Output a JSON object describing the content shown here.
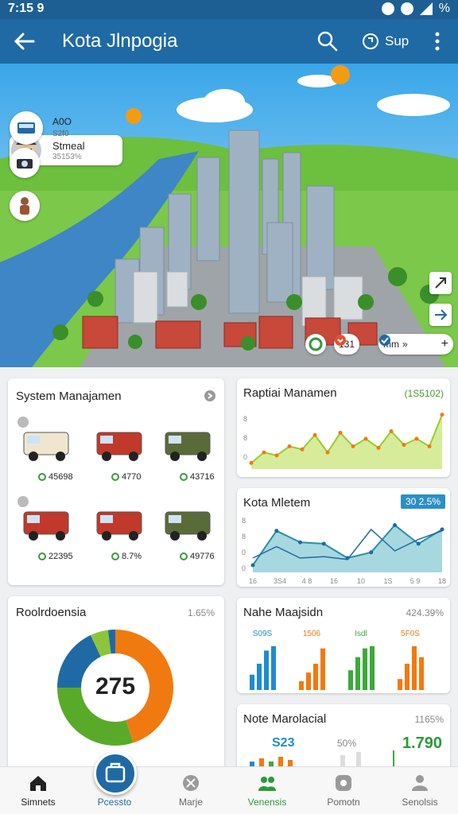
{
  "status": {
    "time": "7:15 9",
    "battery": "%"
  },
  "appbar": {
    "title": "Kota Jlnpogia",
    "action_label": "Sup"
  },
  "user": {
    "name": "Stmeal",
    "sub": "35153%"
  },
  "side_chips": [
    {
      "label": "A0O",
      "sub": "S2f0"
    }
  ],
  "map_pills": [
    {
      "value": "131"
    },
    {
      "value": "mm"
    }
  ],
  "system_card": {
    "title": "System Manajamen",
    "vehicles": [
      {
        "value": "45698",
        "color": "#f0e6d0",
        "icon": "box-truck-icon"
      },
      {
        "value": "4770",
        "color": "#c0392b",
        "icon": "car-icon"
      },
      {
        "value": "43716",
        "color": "#5a6b3a",
        "icon": "military-truck-icon"
      },
      {
        "value": "22395",
        "color": "#c0392b",
        "icon": "bus-icon"
      },
      {
        "value": "8.7%",
        "color": "#c0392b",
        "icon": "bus-icon"
      },
      {
        "value": "49776",
        "color": "#5a6b3a",
        "icon": "jeep-icon"
      }
    ]
  },
  "rapid_card": {
    "title": "Raptiai Manamen",
    "value": "(1S5102)",
    "chart_data": {
      "type": "area",
      "values": [
        8,
        22,
        18,
        30,
        26,
        45,
        22,
        48,
        30,
        40,
        28,
        50,
        32,
        40,
        30,
        72
      ],
      "color": "#9bcc2a",
      "ylim": [
        0,
        80
      ]
    }
  },
  "kota_card": {
    "title": "Kota Mletem",
    "badge": "30 2.5%",
    "chart_data": {
      "type": "area",
      "x": [
        "16",
        "3S4",
        "4 8",
        "16",
        "10",
        "1S",
        "5 9",
        "18"
      ],
      "values": [
        10,
        58,
        42,
        40,
        20,
        28,
        66,
        40,
        60
      ],
      "line2": [
        20,
        36,
        20,
        22,
        18,
        60,
        30,
        46,
        58
      ],
      "ylim": [
        0,
        80
      ],
      "color": "#2b8fa8"
    },
    "y_ticks": [
      "8",
      "8",
      "0",
      "0"
    ]
  },
  "rool_card": {
    "title": "Roolrdoensia",
    "value": "1.65%",
    "center_value": "275",
    "chart_data": {
      "type": "pie",
      "values": [
        45,
        30,
        18,
        5,
        2
      ],
      "colors": [
        "#f07a10",
        "#5aaa2a",
        "#1f6aa5",
        "#8ec43a",
        "#1f6aa5"
      ]
    }
  },
  "nahe_card": {
    "title": "Nahe Maajsidn",
    "value": "424.39%",
    "group_labels": [
      "S09S",
      "1506",
      "Isdl",
      "5F0S"
    ],
    "chart_data": {
      "type": "bar",
      "series": [
        {
          "values": [
            14,
            24,
            36,
            40
          ],
          "color": "#1f8bd0"
        },
        {
          "values": [
            8,
            16,
            24,
            38
          ],
          "color": "#f07a10"
        },
        {
          "values": [
            18,
            30,
            38,
            40
          ],
          "color": "#3aaa3a"
        },
        {
          "values": [
            10,
            24,
            40,
            30
          ],
          "color": "#f07a10"
        }
      ],
      "ylim": [
        0,
        45
      ]
    }
  },
  "note_card": {
    "title": "Note Marolacial",
    "value": "1165%",
    "left_value": "S23",
    "mid_value": "50%",
    "right_value": "1.790"
  },
  "bottomnav": [
    {
      "label": "Simnets",
      "icon": "home-icon",
      "active": true
    },
    {
      "label": "Pcessto",
      "icon": "briefcase-icon",
      "active": true
    },
    {
      "label": "Marje",
      "icon": "tools-icon",
      "active": false
    },
    {
      "label": "Venensis",
      "icon": "people-icon",
      "active": true
    },
    {
      "label": "Pomotn",
      "icon": "image-icon",
      "active": false
    },
    {
      "label": "Senolsis",
      "icon": "profile-icon",
      "active": false
    }
  ]
}
